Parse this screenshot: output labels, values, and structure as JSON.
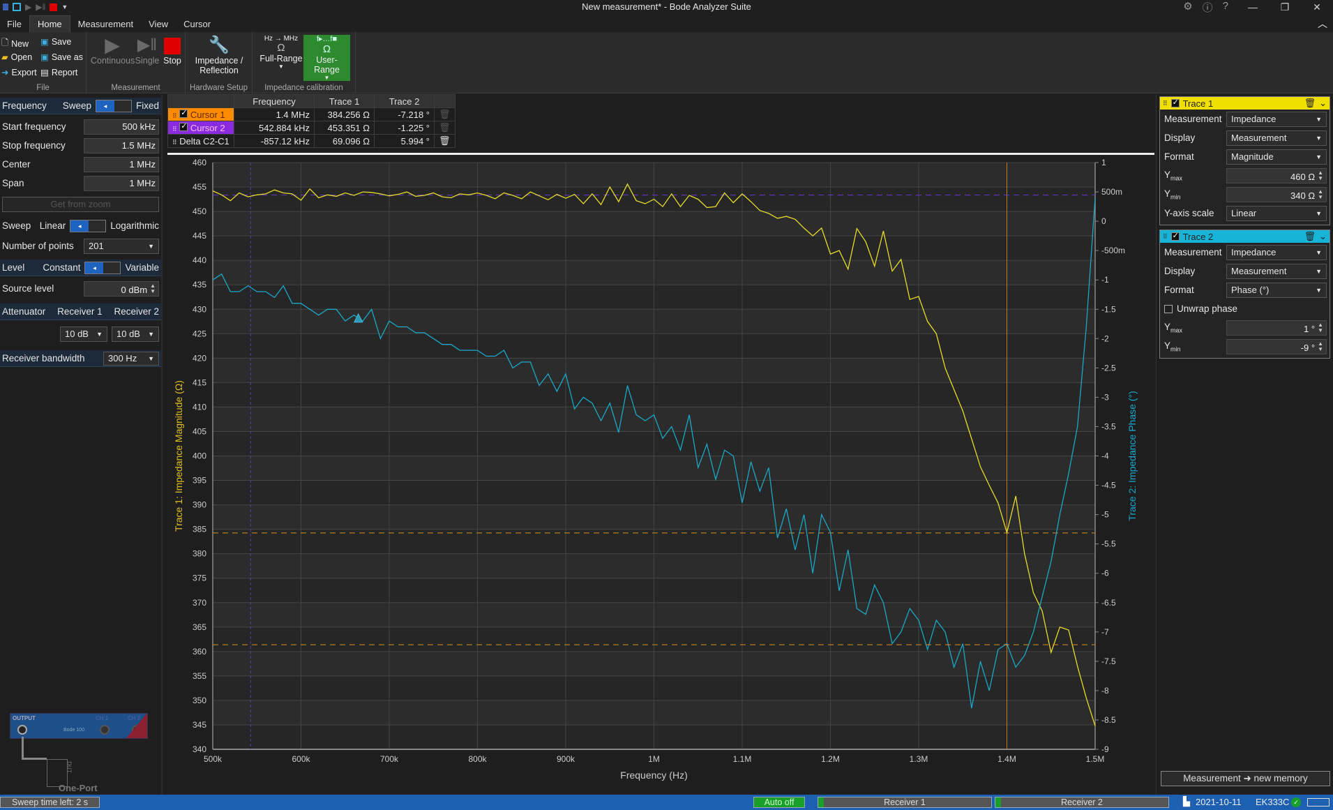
{
  "window": {
    "title": "New measurement* - Bode Analyzer Suite",
    "controls": [
      "minimize",
      "restore",
      "close"
    ],
    "top_icons": [
      "gear-icon",
      "info-icon",
      "help-icon"
    ]
  },
  "menu_tabs": [
    {
      "label": "File"
    },
    {
      "label": "Home",
      "active": true
    },
    {
      "label": "Measurement"
    },
    {
      "label": "View"
    },
    {
      "label": "Cursor"
    }
  ],
  "ribbon": {
    "file_group": {
      "label": "File",
      "new": "New",
      "open": "Open",
      "export": "Export",
      "save": "Save",
      "save_as": "Save as",
      "report": "Report"
    },
    "measurement_group": {
      "label": "Measurement",
      "continuous": "Continuous",
      "single": "Single",
      "stop": "Stop"
    },
    "hardware_group": {
      "label": "Hardware Setup",
      "impedance_line1": "Impedance /",
      "impedance_line2": "Reflection"
    },
    "calibration_group": {
      "label": "Impedance calibration",
      "full_range": "Full-Range",
      "full_range_top": "Hz → MHz",
      "user_range": "User-Range",
      "user_range_top": "f▸…f■",
      "omega": "Ω"
    }
  },
  "left_panel": {
    "frequency": {
      "label": "Frequency",
      "opt_a": "Sweep",
      "opt_b": "Fixed"
    },
    "start_frequency": {
      "label": "Start frequency",
      "value": "500 kHz"
    },
    "stop_frequency": {
      "label": "Stop frequency",
      "value": "1.5 MHz"
    },
    "center": {
      "label": "Center",
      "value": "1 MHz"
    },
    "span": {
      "label": "Span",
      "value": "1 MHz"
    },
    "get_from_zoom": "Get from zoom",
    "sweep": {
      "label": "Sweep",
      "opt_a": "Linear",
      "opt_b": "Logarithmic"
    },
    "num_points": {
      "label": "Number of points",
      "value": "201"
    },
    "level": {
      "label": "Level",
      "opt_a": "Constant",
      "opt_b": "Variable"
    },
    "source_level": {
      "label": "Source level",
      "value": "0 dBm"
    },
    "attenuator": {
      "label": "Attenuator",
      "r1": "Receiver 1",
      "r2": "Receiver 2",
      "r1_value": "10 dB",
      "r2_value": "10 dB"
    },
    "receiver_bandwidth": {
      "label": "Receiver bandwidth",
      "value": "300 Hz"
    },
    "diagram": {
      "output": "OUTPUT",
      "ch1": "CH 1",
      "ch2": "CH 2",
      "device": "Bode 100",
      "dut": "DUT",
      "mode": "One-Port"
    }
  },
  "cursor_table": {
    "headers": [
      "",
      "Frequency",
      "Trace 1",
      "Trace 2"
    ],
    "rows": [
      {
        "name": "Cursor 1",
        "freq": "1.4 MHz",
        "t1": "384.256 Ω",
        "t2": "-7.218 °",
        "color": "#ff8c00",
        "checked": true
      },
      {
        "name": "Cursor 2",
        "freq": "542.884 kHz",
        "t1": "453.351 Ω",
        "t2": "-1.225 °",
        "color": "#8a2be2",
        "checked": true
      },
      {
        "name": "Delta C2-C1",
        "freq": "-857.12 kHz",
        "t1": "69.096 Ω",
        "t2": "5.994 °"
      }
    ]
  },
  "right_panel": {
    "trace1": {
      "title": "Trace 1",
      "color": "#f0e000",
      "checked": true,
      "measurement_label": "Measurement",
      "measurement": "Impedance",
      "display_label": "Display",
      "display": "Measurement",
      "format_label": "Format",
      "format": "Magnitude",
      "ymax_label": "Y",
      "ymax_sub": "max",
      "ymax": "460 Ω",
      "ymin_label": "Y",
      "ymin_sub": "min",
      "ymin": "340 Ω",
      "yscale_label": "Y-axis scale",
      "yscale": "Linear"
    },
    "trace2": {
      "title": "Trace 2",
      "color": "#18b4d8",
      "checked": true,
      "measurement_label": "Measurement",
      "measurement": "Impedance",
      "display_label": "Display",
      "display": "Measurement",
      "format_label": "Format",
      "format": "Phase (°)",
      "unwrap_label": "Unwrap phase",
      "unwrap": false,
      "ymax_label": "Y",
      "ymax_sub": "max",
      "ymax": "1 °",
      "ymin_label": "Y",
      "ymin_sub": "min",
      "ymin": "-9 °"
    },
    "new_memory": "Measurement ➜ new memory"
  },
  "status_bar": {
    "sweep_time": "Sweep time left: 2 s",
    "auto": "Auto off",
    "receiver1": "Receiver 1",
    "receiver2": "Receiver 2",
    "date": "2021-10-11",
    "device": "EK333C"
  },
  "chart_data": {
    "type": "line",
    "xlabel": "Frequency (Hz)",
    "ylabel_left": "Trace 1: Impedance Magnitude (Ω)",
    "ylabel_right": "Trace 2: Impedance Phase (°)",
    "xlim": [
      500000,
      1500000
    ],
    "ylim_left": [
      340,
      460
    ],
    "ylim_right": [
      -9,
      1
    ],
    "grid": true,
    "x_ticks": [
      "500k",
      "600k",
      "700k",
      "800k",
      "900k",
      "1M",
      "1.1M",
      "1.2M",
      "1.3M",
      "1.4M",
      "1.5M"
    ],
    "y_ticks_left": [
      "460",
      "455",
      "450",
      "445",
      "440",
      "435",
      "430",
      "425",
      "420",
      "415",
      "410",
      "405",
      "400",
      "395",
      "390",
      "385",
      "380",
      "375",
      "370",
      "365",
      "360",
      "355",
      "350",
      "345",
      "340"
    ],
    "y_ticks_right": [
      "1",
      "500m",
      "0",
      "-500m",
      "-1",
      "-1.5",
      "-2",
      "-2.5",
      "-3",
      "-3.5",
      "-4",
      "-4.5",
      "-5",
      "-5.5",
      "-6",
      "-6.5",
      "-7",
      "-7.5",
      "-8",
      "-8.5",
      "-9"
    ],
    "cursors": [
      {
        "name": "Cursor 1",
        "x": 1400000,
        "y_left": 384.256,
        "y_right": -7.218,
        "color": "#e08a20"
      },
      {
        "name": "Cursor 2",
        "x": 542884,
        "y_left": 453.351,
        "y_right": -1.225,
        "color": "#6a3ad0"
      }
    ],
    "series": [
      {
        "name": "Trace 1",
        "axis": "left",
        "color": "#e8dc2a",
        "x": [
          500000,
          510000,
          520000,
          530000,
          540000,
          550000,
          560000,
          570000,
          580000,
          590000,
          600000,
          610000,
          620000,
          630000,
          640000,
          650000,
          660000,
          670000,
          680000,
          690000,
          700000,
          710000,
          720000,
          730000,
          740000,
          750000,
          760000,
          770000,
          780000,
          790000,
          800000,
          810000,
          820000,
          830000,
          840000,
          850000,
          860000,
          870000,
          880000,
          890000,
          900000,
          910000,
          920000,
          930000,
          940000,
          950000,
          960000,
          970000,
          980000,
          990000,
          1000000,
          1010000,
          1020000,
          1030000,
          1040000,
          1050000,
          1060000,
          1070000,
          1080000,
          1090000,
          1100000,
          1110000,
          1120000,
          1130000,
          1140000,
          1150000,
          1160000,
          1170000,
          1180000,
          1190000,
          1200000,
          1210000,
          1220000,
          1230000,
          1240000,
          1250000,
          1260000,
          1270000,
          1280000,
          1290000,
          1300000,
          1310000,
          1320000,
          1330000,
          1340000,
          1350000,
          1360000,
          1370000,
          1380000,
          1390000,
          1400000,
          1410000,
          1420000,
          1430000,
          1440000,
          1450000,
          1460000,
          1470000,
          1480000,
          1490000,
          1500000
        ],
        "y": [
          454.2,
          453.4,
          452.2,
          453.8,
          453.0,
          453.4,
          453.6,
          454.4,
          453.8,
          453.6,
          452.3,
          454.6,
          452.8,
          453.4,
          453.1,
          453.8,
          453.3,
          454.0,
          453.9,
          453.6,
          453.2,
          453.5,
          454.0,
          453.1,
          453.3,
          453.8,
          453.0,
          452.8,
          453.6,
          453.4,
          453.8,
          453.3,
          452.6,
          453.8,
          453.3,
          452.6,
          454.0,
          453.2,
          452.4,
          453.5,
          452.7,
          453.5,
          451.6,
          453.6,
          451.4,
          455.0,
          452.0,
          455.6,
          452.2,
          451.6,
          452.5,
          451.0,
          453.6,
          451.0,
          453.3,
          452.5,
          450.8,
          451.0,
          453.8,
          451.8,
          453.6,
          452.0,
          450.2,
          449.6,
          448.6,
          449.0,
          448.4,
          446.6,
          445.0,
          446.6,
          441.3,
          442.0,
          438.2,
          446.5,
          443.8,
          438.8,
          446.0,
          437.8,
          440.2,
          432.0,
          432.6,
          427.5,
          425.0,
          418.0,
          413.6,
          409.2,
          403.5,
          397.8,
          394.0,
          390.4,
          384.3,
          391.8,
          380.0,
          372.0,
          368.3,
          359.8,
          365.0,
          364.4,
          357.0,
          350.5,
          344.8
        ]
      },
      {
        "name": "Trace 2",
        "axis": "right",
        "color": "#1aa8c8",
        "x": [
          500000,
          510000,
          520000,
          530000,
          540000,
          550000,
          560000,
          570000,
          580000,
          590000,
          600000,
          610000,
          620000,
          630000,
          640000,
          650000,
          660000,
          670000,
          680000,
          690000,
          700000,
          710000,
          720000,
          730000,
          740000,
          750000,
          760000,
          770000,
          780000,
          790000,
          800000,
          810000,
          820000,
          830000,
          840000,
          850000,
          860000,
          870000,
          880000,
          890000,
          900000,
          910000,
          920000,
          930000,
          940000,
          950000,
          960000,
          970000,
          980000,
          990000,
          1000000,
          1010000,
          1020000,
          1030000,
          1040000,
          1050000,
          1060000,
          1070000,
          1080000,
          1090000,
          1100000,
          1110000,
          1120000,
          1130000,
          1140000,
          1150000,
          1160000,
          1170000,
          1180000,
          1190000,
          1200000,
          1210000,
          1220000,
          1230000,
          1240000,
          1250000,
          1260000,
          1270000,
          1280000,
          1290000,
          1300000,
          1310000,
          1320000,
          1330000,
          1340000,
          1350000,
          1360000,
          1370000,
          1380000,
          1390000,
          1400000,
          1410000,
          1420000,
          1430000,
          1440000,
          1450000,
          1460000,
          1470000,
          1480000,
          1490000,
          1500000
        ],
        "y": [
          -1.0,
          -0.9,
          -1.2,
          -1.2,
          -1.1,
          -1.2,
          -1.2,
          -1.3,
          -1.1,
          -1.4,
          -1.4,
          -1.5,
          -1.6,
          -1.5,
          -1.5,
          -1.7,
          -1.6,
          -1.7,
          -1.5,
          -2.0,
          -1.7,
          -1.8,
          -1.8,
          -1.9,
          -1.9,
          -2.0,
          -2.1,
          -2.1,
          -2.2,
          -2.2,
          -2.2,
          -2.3,
          -2.3,
          -2.2,
          -2.5,
          -2.4,
          -2.4,
          -2.8,
          -2.6,
          -2.9,
          -2.6,
          -3.2,
          -3.0,
          -3.1,
          -3.4,
          -3.1,
          -3.6,
          -2.8,
          -3.3,
          -3.4,
          -3.3,
          -3.7,
          -3.5,
          -3.9,
          -3.3,
          -4.2,
          -3.8,
          -4.4,
          -3.9,
          -4.0,
          -4.8,
          -4.1,
          -4.6,
          -4.2,
          -5.4,
          -4.9,
          -5.6,
          -5.0,
          -6.0,
          -5.0,
          -5.3,
          -6.3,
          -5.6,
          -6.6,
          -6.7,
          -6.2,
          -6.5,
          -7.2,
          -7.0,
          -6.6,
          -6.8,
          -7.3,
          -6.8,
          -7.0,
          -7.6,
          -7.2,
          -8.3,
          -7.5,
          -8.0,
          -7.3,
          -7.2,
          -7.6,
          -7.4,
          -7.0,
          -6.4,
          -5.8,
          -5.0,
          -4.3,
          -3.5,
          -1.8,
          0.4
        ]
      }
    ]
  }
}
